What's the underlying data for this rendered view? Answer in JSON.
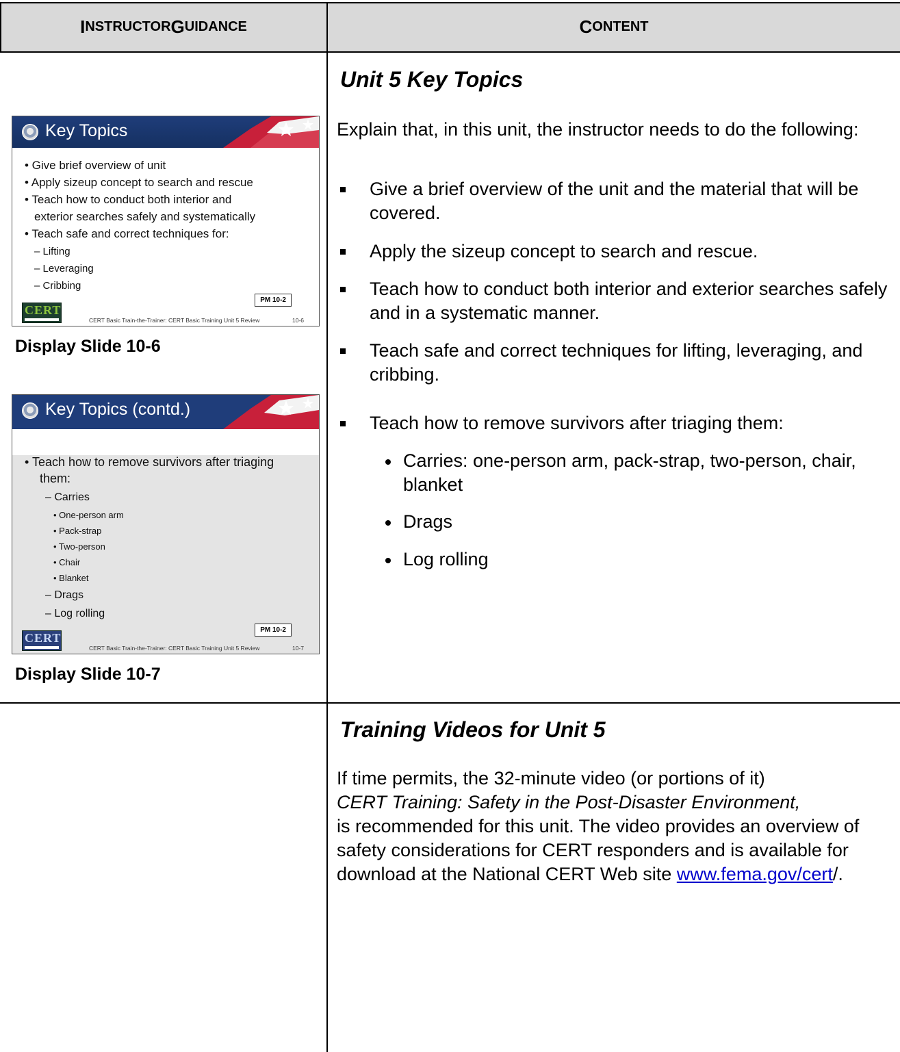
{
  "header": {
    "left_cap": "I",
    "left_rest": "NSTRUCTOR ",
    "left_cap2": "G",
    "left_rest2": "UIDANCE",
    "right_cap": "C",
    "right_rest": "ONTENT"
  },
  "slide1": {
    "title": "Key Topics",
    "bullets": [
      "• Give brief overview of unit",
      "• Apply sizeup concept to search and rescue",
      "• Teach how to conduct both interior and",
      "exterior searches safely and systematically",
      "• Teach safe and correct techniques for:"
    ],
    "sub": [
      "– Lifting",
      "– Leveraging",
      "– Cribbing"
    ],
    "pm": "PM 10-2",
    "logo": "CERT",
    "footer": "CERT Basic Train-the-Trainer: CERT Basic Training Unit 5 Review",
    "number": "10-6",
    "caption": "Display Slide 10-6"
  },
  "slide2": {
    "title": "Key Topics (contd.)",
    "bullets": [
      "• Teach how to remove survivors after triaging",
      "them:"
    ],
    "sub": [
      "– Carries",
      "– Drags",
      "– Log rolling"
    ],
    "subsub": [
      "• One-person arm",
      "• Pack-strap",
      "• Two-person",
      "• Chair",
      "• Blanket"
    ],
    "pm": "PM 10-2",
    "logo": "CERT",
    "footer": "CERT Basic Train-the-Trainer: CERT Basic Training Unit 5 Review",
    "number": "10-7",
    "caption": "Display Slide 10-7"
  },
  "section1": {
    "heading": "Unit 5 Key Topics",
    "intro": "Explain that, in this unit, the instructor needs to do the following:",
    "items": [
      "Give a brief overview of the unit and the material that will be covered.",
      "Apply the sizeup concept to search and rescue.",
      "Teach how to conduct both interior and exterior searches safely and in a systematic manner.",
      "Teach safe and correct techniques for lifting, leveraging, and cribbing.",
      "Teach how to remove survivors after triaging them:"
    ],
    "subitems": [
      "Carries: one-person arm, pack-strap, two-person, chair, blanket",
      "Drags",
      "Log rolling"
    ]
  },
  "section2": {
    "heading": "Training Videos for Unit 5",
    "p1": "If time permits, the 32-minute video (or portions of it)",
    "video_title": "CERT Training: Safety in the Post-Disaster Environment,",
    "p2": "is recommended for this unit. The video provides an overview of safety considerations for CERT responders and is available for download at the National CERT Web site ",
    "link": "www.fema.gov/cert",
    "p3": "/."
  }
}
